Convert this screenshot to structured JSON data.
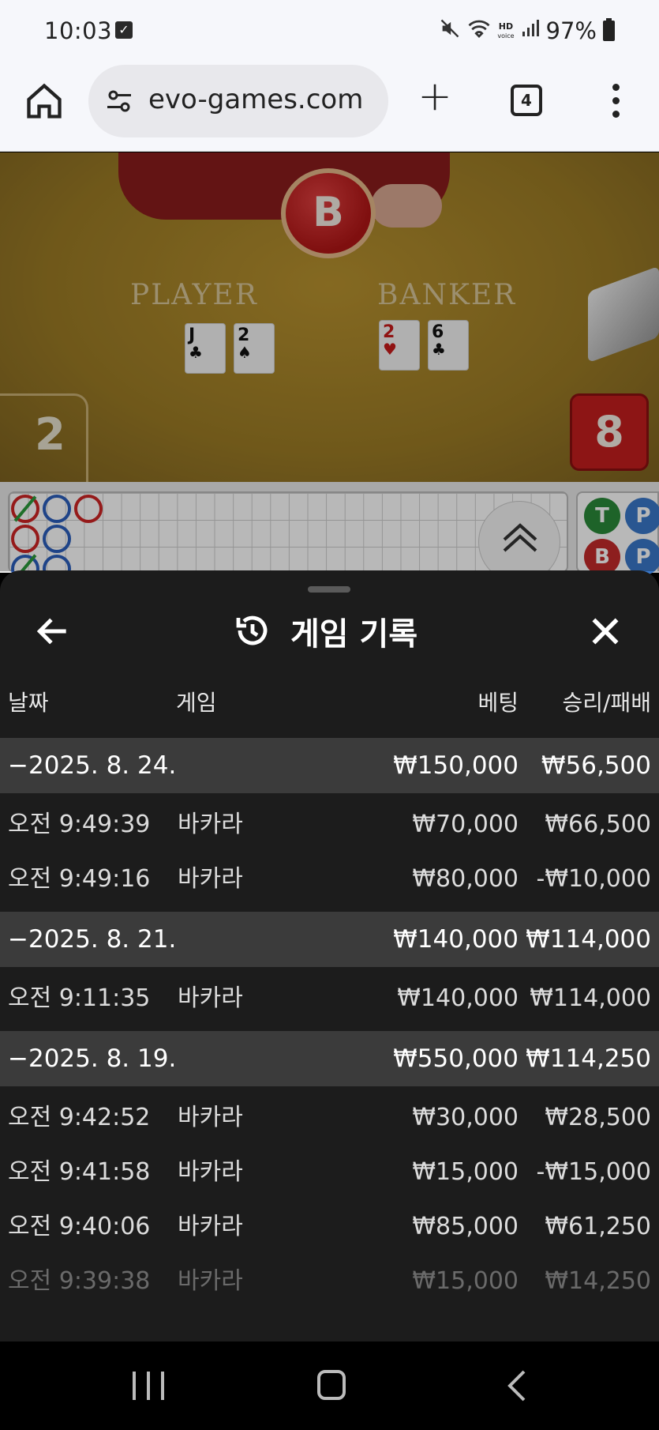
{
  "status": {
    "time": "10:03",
    "hd_top": "HD",
    "hd_bottom": "voice",
    "battery": "97%"
  },
  "browser": {
    "url": "evo-games.com",
    "tab_count": "4",
    "new_tab_glyph": "+"
  },
  "game": {
    "chip_label": "B",
    "player_label": "PLAYER",
    "banker_label": "BANKER",
    "player_score": "2",
    "banker_score": "8",
    "player_cards": [
      {
        "rank": "J",
        "suit": "♣"
      },
      {
        "rank": "2",
        "suit": "♠"
      }
    ],
    "banker_cards": [
      {
        "rank": "2",
        "suit": "♥"
      },
      {
        "rank": "6",
        "suit": "♣"
      }
    ]
  },
  "road": {
    "side_pills": [
      "T",
      "P",
      "B",
      "P"
    ]
  },
  "history": {
    "title": "게임 기록",
    "columns": {
      "date": "날짜",
      "game": "게임",
      "bet": "베팅",
      "result": "승리/패배"
    },
    "rows": [
      {
        "type": "group",
        "date": "−2025. 8. 24.",
        "game": "",
        "bet": "₩150,000",
        "result": "₩56,500"
      },
      {
        "type": "item",
        "date": "오전 9:49:39",
        "game": "바카라",
        "bet": "₩70,000",
        "result": "₩66,500"
      },
      {
        "type": "item",
        "date": "오전 9:49:16",
        "game": "바카라",
        "bet": "₩80,000",
        "result": "-₩10,000"
      },
      {
        "type": "group",
        "date": "−2025. 8. 21.",
        "game": "",
        "bet": "₩140,000",
        "result": "₩114,000"
      },
      {
        "type": "item",
        "date": "오전 9:11:35",
        "game": "바카라",
        "bet": "₩140,000",
        "result": "₩114,000"
      },
      {
        "type": "group",
        "date": "−2025. 8. 19.",
        "game": "",
        "bet": "₩550,000",
        "result": "₩114,250"
      },
      {
        "type": "item",
        "date": "오전 9:42:52",
        "game": "바카라",
        "bet": "₩30,000",
        "result": "₩28,500"
      },
      {
        "type": "item",
        "date": "오전 9:41:58",
        "game": "바카라",
        "bet": "₩15,000",
        "result": "-₩15,000"
      },
      {
        "type": "item",
        "date": "오전 9:40:06",
        "game": "바카라",
        "bet": "₩85,000",
        "result": "₩61,250"
      },
      {
        "type": "faded",
        "date": "오전 9:39:38",
        "game": "바카라",
        "bet": "₩15,000",
        "result": "₩14,250"
      }
    ]
  }
}
